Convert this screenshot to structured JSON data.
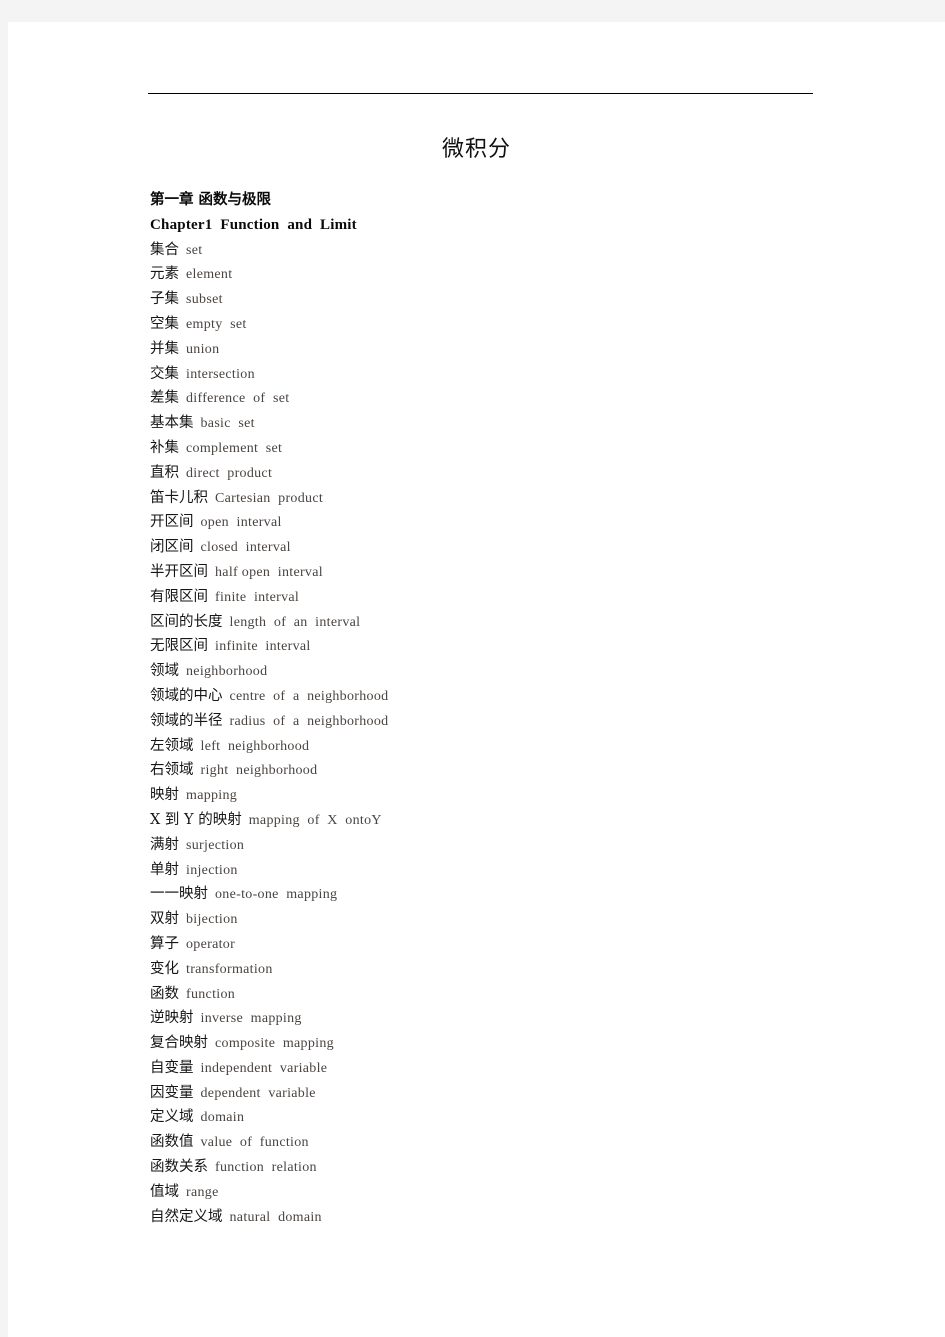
{
  "page": {
    "title": "微积分",
    "background_color": "#f4f4f4",
    "sheet_color": "#ffffff",
    "rule_color": "#000000"
  },
  "headings": [
    {
      "text": "第一章 函数与极限",
      "script": "cn"
    },
    {
      "text": "Chapter1  Function  and  Limit",
      "script": "latin"
    }
  ],
  "glossary": [
    {
      "cn": "集合",
      "en": "set"
    },
    {
      "cn": "元素",
      "en": "element"
    },
    {
      "cn": "子集",
      "en": "subset"
    },
    {
      "cn": "空集",
      "en": "empty  set"
    },
    {
      "cn": "并集",
      "en": "union"
    },
    {
      "cn": "交集",
      "en": "intersection"
    },
    {
      "cn": "差集",
      "en": "difference  of  set"
    },
    {
      "cn": "基本集",
      "en": "basic  set"
    },
    {
      "cn": "补集",
      "en": "complement  set"
    },
    {
      "cn": "直积",
      "en": "direct  product"
    },
    {
      "cn": "笛卡儿积",
      "en": "Cartesian  product"
    },
    {
      "cn": "开区间",
      "en": "open  interval"
    },
    {
      "cn": "闭区间",
      "en": "closed  interval"
    },
    {
      "cn": "半开区间",
      "en": "half open  interval"
    },
    {
      "cn": "有限区间",
      "en": "finite  interval"
    },
    {
      "cn": "区间的长度",
      "en": "length  of  an  interval"
    },
    {
      "cn": "无限区间",
      "en": "infinite  interval"
    },
    {
      "cn": "领域",
      "en": "neighborhood"
    },
    {
      "cn": "领域的中心",
      "en": "centre  of  a  neighborhood"
    },
    {
      "cn": "领域的半径",
      "en": "radius  of  a  neighborhood"
    },
    {
      "cn": "左领域",
      "en": "left  neighborhood"
    },
    {
      "cn": "右领域",
      "en": "right  neighborhood"
    },
    {
      "cn": "映射",
      "en": "mapping"
    },
    {
      "cn": "X 到 Y 的映射",
      "en": "mapping  of  X  ontoY"
    },
    {
      "cn": "满射",
      "en": "surjection"
    },
    {
      "cn": "单射",
      "en": "injection"
    },
    {
      "cn": "一一映射",
      "en": "one-to-one  mapping"
    },
    {
      "cn": "双射",
      "en": "bijection"
    },
    {
      "cn": "算子",
      "en": "operator"
    },
    {
      "cn": "变化",
      "en": "transformation"
    },
    {
      "cn": "函数",
      "en": "function"
    },
    {
      "cn": "逆映射",
      "en": "inverse  mapping"
    },
    {
      "cn": "复合映射",
      "en": "composite  mapping"
    },
    {
      "cn": "自变量",
      "en": "independent  variable"
    },
    {
      "cn": "因变量",
      "en": "dependent  variable"
    },
    {
      "cn": "定义域",
      "en": "domain"
    },
    {
      "cn": "函数值",
      "en": "value  of  function"
    },
    {
      "cn": "函数关系",
      "en": "function  relation"
    },
    {
      "cn": "值域",
      "en": "range"
    },
    {
      "cn": "自然定义域",
      "en": "natural  domain"
    }
  ]
}
